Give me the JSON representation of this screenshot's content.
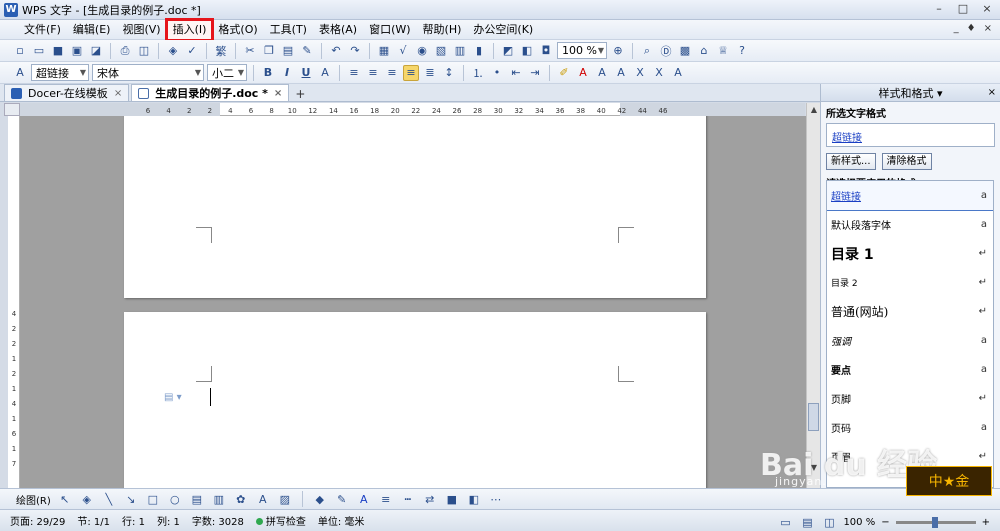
{
  "window": {
    "title": "WPS 文字 - [生成目录的例子.doc *]",
    "app_logo": "W",
    "controls": [
      "–",
      "□",
      "×"
    ]
  },
  "menu": {
    "items": [
      "文件(F)",
      "编辑(E)",
      "视图(V)",
      "插入(I)",
      "格式(O)",
      "工具(T)",
      "表格(A)",
      "窗口(W)",
      "帮助(H)",
      "办公空间(K)"
    ],
    "highlighted_index": 3,
    "right_controls": [
      "_",
      "♦",
      "×"
    ]
  },
  "toolbar1": {
    "zoom": "100 %"
  },
  "toolbar2": {
    "style": "超链接",
    "font": "宋体",
    "size": "小二",
    "bold": "B",
    "italic": "I",
    "underline": "U"
  },
  "tabs": [
    {
      "label": "Docer-在线模板",
      "close": "×"
    },
    {
      "label": "生成目录的例子.doc *",
      "close": "×"
    }
  ],
  "tab_add": "+",
  "ruler": {
    "ticks": [
      "6",
      "4",
      "2",
      "2",
      "4",
      "6",
      "8",
      "10",
      "12",
      "14",
      "16",
      "18",
      "20",
      "22",
      "24",
      "26",
      "28",
      "30",
      "32",
      "34",
      "36",
      "38",
      "40",
      "42",
      "44",
      "46"
    ]
  },
  "vruler": {
    "ticks": [
      "4",
      "2",
      "2",
      "1",
      "2",
      "1",
      "4",
      "1",
      "6",
      "1",
      "7"
    ]
  },
  "pane": {
    "title": "样式和格式 ▾",
    "selected_label": "所选文字格式",
    "current_style": "超链接",
    "new_style_btn": "新样式...",
    "clear_btn": "清除格式",
    "apply_label": "请选择要应用的格式",
    "styles": [
      {
        "name": "超链接",
        "mark": "a",
        "cls": "link"
      },
      {
        "name": "默认段落字体",
        "mark": "a",
        "cls": "plain"
      },
      {
        "name": "目录 1",
        "mark": "↵",
        "cls": "h1"
      },
      {
        "name": "目录 2",
        "mark": "↵",
        "cls": "small"
      },
      {
        "name": "普通(网站)",
        "mark": "↵",
        "cls": "web"
      },
      {
        "name": "强调",
        "mark": "a",
        "cls": "italic"
      },
      {
        "name": "要点",
        "mark": "a",
        "cls": "bold"
      },
      {
        "name": "页脚",
        "mark": "↵",
        "cls": "plain"
      },
      {
        "name": "页码",
        "mark": "a",
        "cls": "plain"
      },
      {
        "name": "页眉",
        "mark": "↵",
        "cls": "plain"
      }
    ]
  },
  "drawbar": {
    "label": "绘图(R)"
  },
  "status": {
    "page": "页面: 29/29",
    "section": "节: 1/1",
    "row": "行: 1",
    "col": "列: 1",
    "words": "字数: 3028",
    "spell": "拼写检查",
    "unit": "单位: 毫米",
    "zoom": "100 %"
  },
  "watermark": {
    "brand": "Bai du 经验",
    "sub": "jingyan.baidu.com",
    "badge": "中★金"
  }
}
